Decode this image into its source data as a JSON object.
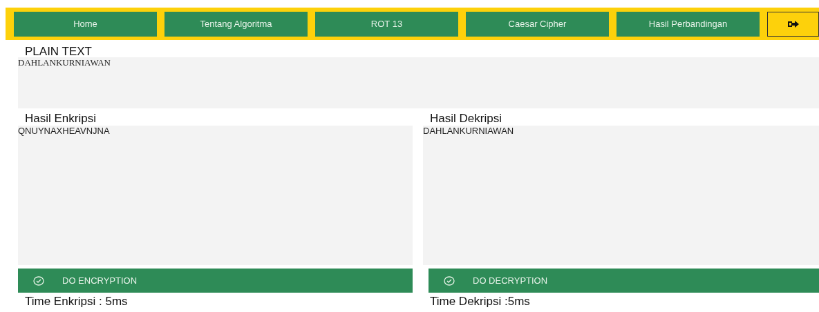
{
  "nav": {
    "items": [
      {
        "label": "Home"
      },
      {
        "label": "Tentang Algoritma"
      },
      {
        "label": "ROT 13"
      },
      {
        "label": "Caesar Cipher"
      },
      {
        "label": "Hasil Perbandingan"
      }
    ]
  },
  "plain_text": {
    "label": "PLAIN TEXT",
    "value": "DAHLANKURNIAWAN"
  },
  "panels": [
    {
      "label": "Hasil Enkripsi",
      "value": "QNUYNAXHEAVNJNA",
      "button": "DO ENCRYPTION",
      "time": "Time Enkripsi : 5ms"
    },
    {
      "label": "Hasil Dekripsi",
      "value": "DAHLANKURNIAWAN",
      "button": "DO DECRYPTION",
      "time": "Time Dekripsi :5ms"
    }
  ]
}
